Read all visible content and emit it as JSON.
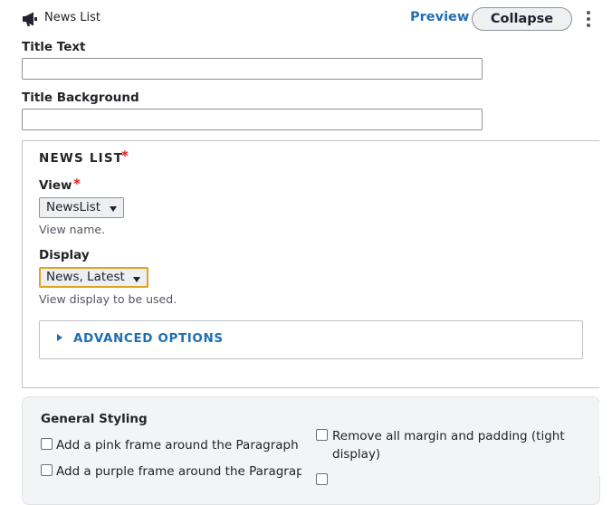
{
  "header": {
    "paragraph_type": "News List",
    "preview_label": "Preview",
    "collapse_label": "Collapse"
  },
  "fields": {
    "title_text": {
      "label": "Title Text",
      "value": ""
    },
    "title_background": {
      "label": "Title Background",
      "value": ""
    }
  },
  "news_list": {
    "legend": "NEWS LIST",
    "required_marker": "*",
    "view": {
      "label": "View",
      "selected": "NewsList",
      "description": "View name."
    },
    "display": {
      "label": "Display",
      "selected": "News, Latest",
      "description": "View display to be used."
    },
    "advanced_options_label": "ADVANCED OPTIONS"
  },
  "general_styling": {
    "title": "General Styling",
    "options": [
      {
        "label": "Add a pink frame around the Paragraph",
        "checked": false
      },
      {
        "label": "Add a purple frame around the Paragraph",
        "checked": false
      },
      {
        "label": "Remove all margin and padding (tight display)",
        "checked": false
      }
    ]
  },
  "colors": {
    "link_blue": "#1f6fb2",
    "required_red": "#dc2323",
    "focus_outline": "#e0a31e"
  }
}
